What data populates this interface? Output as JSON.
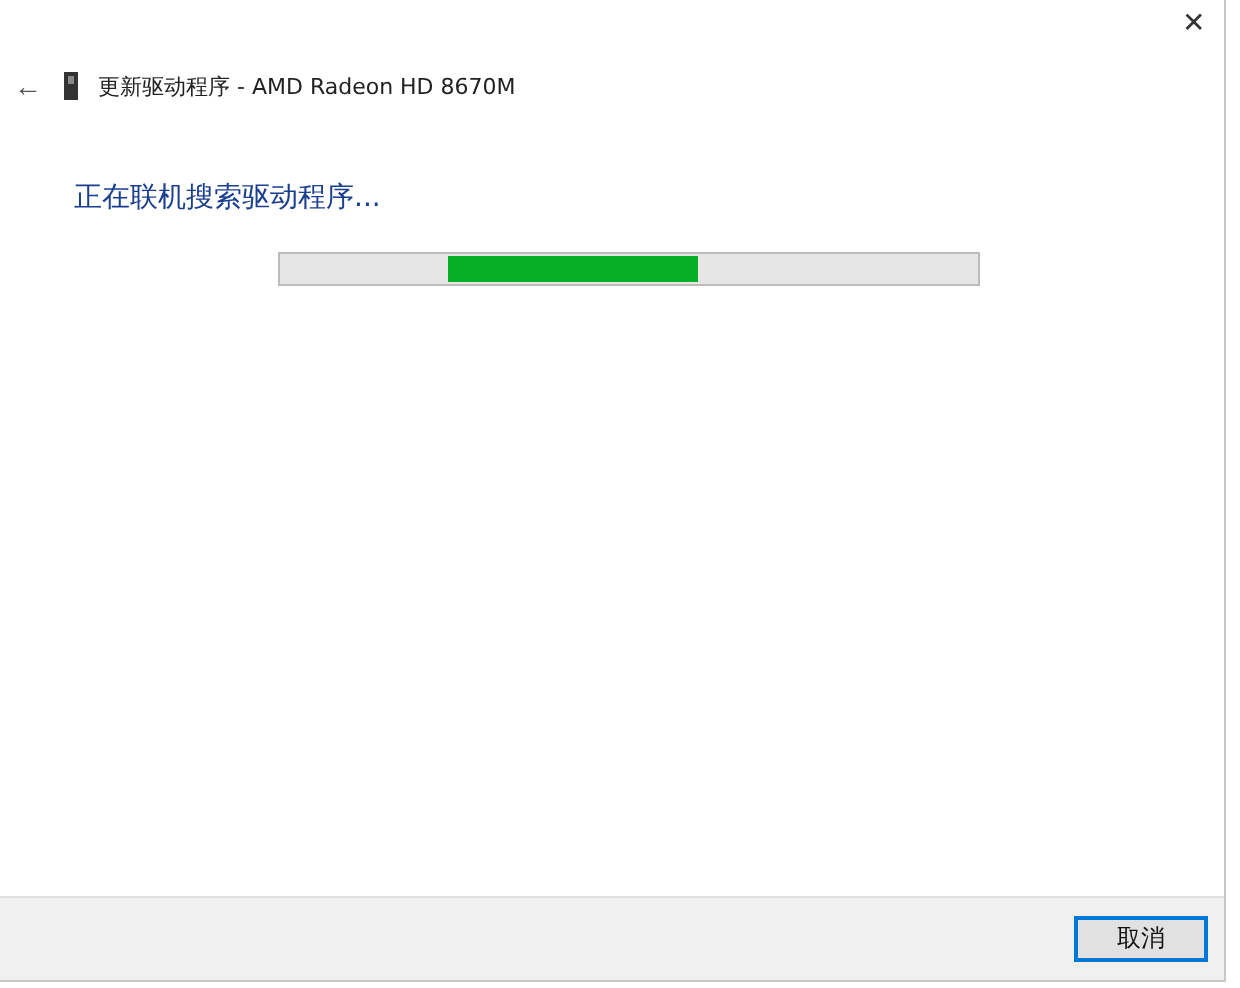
{
  "window": {
    "close": "✕",
    "back": "←",
    "title": "更新驱动程序 - AMD Radeon HD 8670M"
  },
  "status": "正在联机搜索驱动程序...",
  "progress": {
    "level": 0.36
  },
  "buttons": [
    {
      "label": "取消",
      "focused": true
    }
  ]
}
